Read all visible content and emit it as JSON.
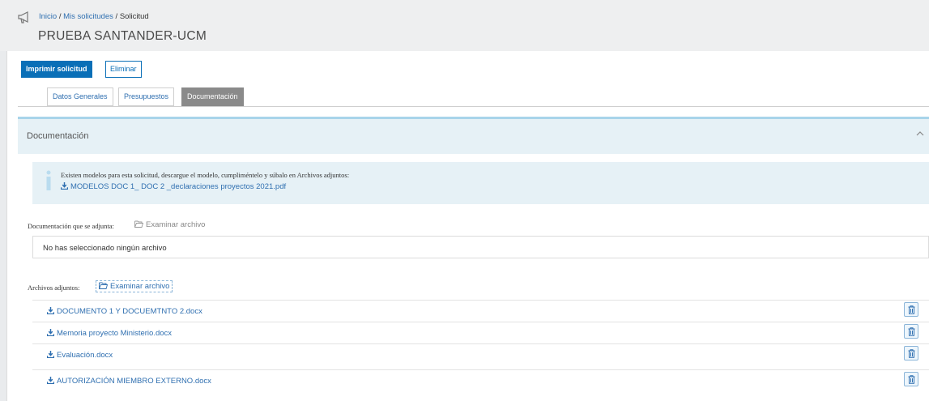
{
  "breadcrumb": {
    "home": "Inicio",
    "sep1": " / ",
    "requests": "Mis solicitudes",
    "sep2": " / ",
    "current": "Solicitud"
  },
  "page_title": "PRUEBA SANTANDER-UCM",
  "toolbar": {
    "print_label": "Imprimir solicitud",
    "delete_label": "Eliminar"
  },
  "tabs": [
    {
      "label": "Datos Generales",
      "active": false
    },
    {
      "label": "Presupuestos",
      "active": false
    },
    {
      "label": "Documentación",
      "active": true
    }
  ],
  "section": {
    "title": "Documentación"
  },
  "info": {
    "text": "Existen modelos para esta solicitud, descargue el modelo, cumpliméntelo y súbalo en Archivos adjuntos:",
    "link": "MODELOS DOC 1_ DOC 2 _declaraciones proyectos 2021.pdf"
  },
  "attach_doc": {
    "label": "Documentación que se adjunta:",
    "browse": "Examinar archivo",
    "no_file": "No has seleccionado ningún archivo"
  },
  "attachments": {
    "label": "Archivos adjuntos:",
    "browse": "Examinar archivo",
    "files": [
      "DOCUMENTO 1 Y DOCUEMTNTO 2.docx",
      "Memoria proyecto Ministerio.docx",
      "Evaluación.docx",
      "AUTORIZACIÓN MIEMBRO EXTERNO.docx"
    ]
  },
  "colors": {
    "primary": "#0a6fb7",
    "link": "#2f6fb0",
    "info_bg": "#e6f1f6",
    "active_tab": "#8a8a8a"
  },
  "icons": {
    "header": "megaphone-icon",
    "download": "download-icon",
    "folder": "folder-open-icon",
    "delete": "trash-icon",
    "info": "info-icon",
    "collapse": "chevron-up-icon"
  }
}
